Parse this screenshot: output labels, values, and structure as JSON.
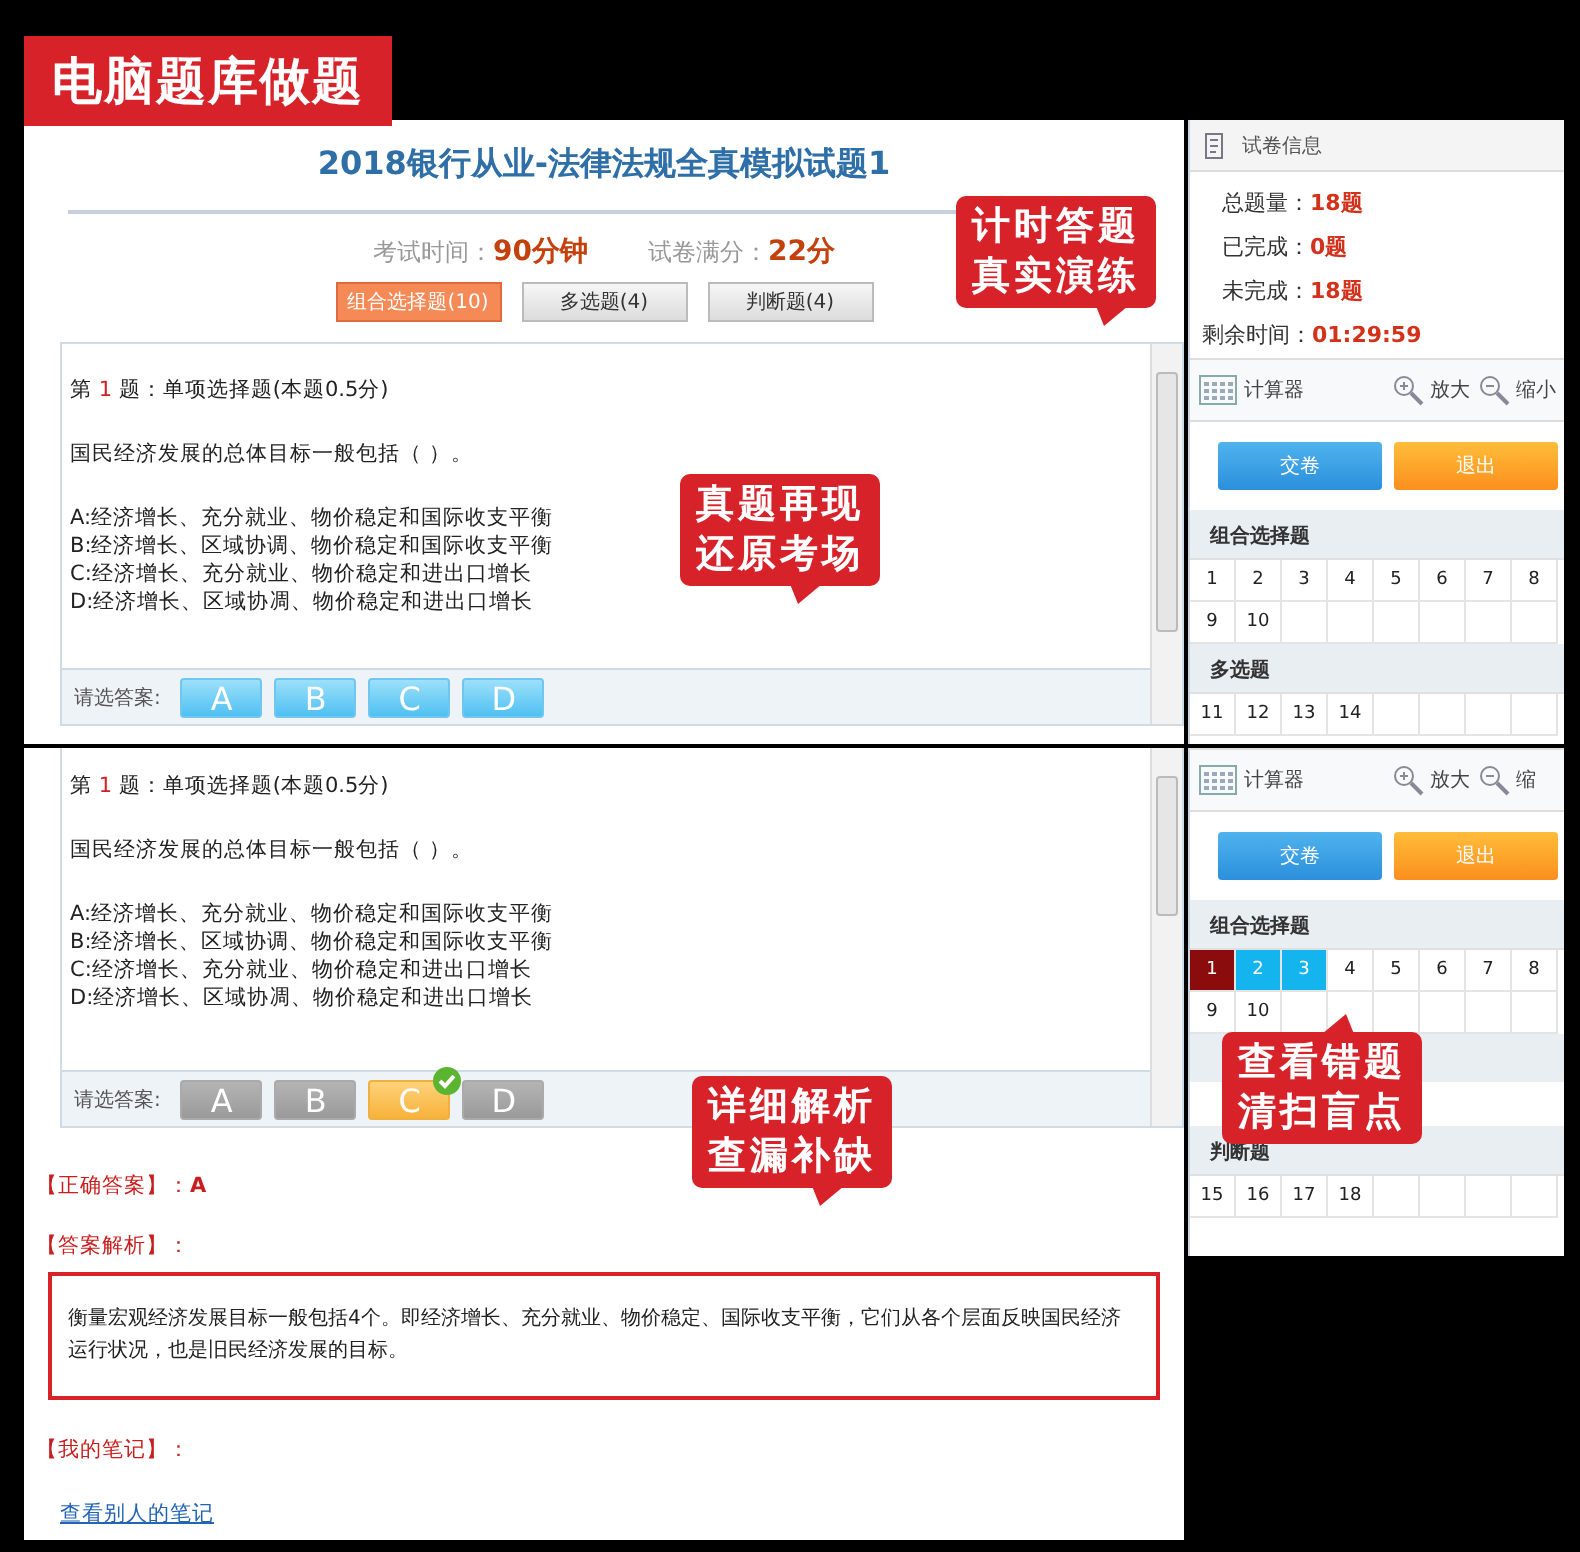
{
  "banner": {
    "title": "电脑题库做题"
  },
  "exam_view": {
    "title": "2018银行从业-法律法规全真模拟试题1",
    "info": [
      {
        "label": "考试时间：",
        "value": "90分钟"
      },
      {
        "label": "试卷满分：",
        "value": "22分"
      }
    ],
    "tabs": [
      {
        "label": "组合选择题(10)",
        "selected": true
      },
      {
        "label": "多选题(4)",
        "selected": false
      },
      {
        "label": "判断题(4)",
        "selected": false
      }
    ],
    "question": {
      "prefix": "第",
      "number": "1",
      "suffix": "题：单项选择题(本题0.5分)",
      "stem": "国民经济发展的总体目标一般包括（ ）。",
      "options": [
        "A:经济增长、充分就业、物价稳定和国际收支平衡",
        "B:经济增长、区域协调、物价稳定和国际收支平衡",
        "C:经济增长、充分就业、物价稳定和进出口增长",
        "D:经济增长、区域协凋、物价稳定和进出口增长"
      ]
    },
    "answer_prompt": "请选答案:",
    "answers_enabled": true,
    "answers": [
      {
        "label": "A",
        "selected": false
      },
      {
        "label": "B",
        "selected": false
      },
      {
        "label": "C",
        "selected": false
      },
      {
        "label": "D",
        "selected": false
      }
    ],
    "callouts": [
      {
        "lines": [
          "计时答题",
          "真实演练"
        ]
      },
      {
        "lines": [
          "真题再现",
          "还原考场"
        ]
      }
    ]
  },
  "exam_sidebar": {
    "header": "试卷信息",
    "stats": [
      {
        "label": "总题量：",
        "value": "18题"
      },
      {
        "label": "已完成：",
        "value": "0题"
      },
      {
        "label": "未完成：",
        "value": "18题"
      },
      {
        "label": "剩余时间：",
        "value": "01:29:59"
      }
    ],
    "tools": [
      {
        "kind": "calculator",
        "label": "计算器"
      },
      {
        "kind": "zoom_in",
        "label": "放大"
      },
      {
        "kind": "zoom_out",
        "label": "缩小"
      }
    ],
    "actions": [
      {
        "kind": "submit",
        "label": "交卷"
      },
      {
        "kind": "exit",
        "label": "退出"
      }
    ],
    "sections": [
      {
        "title": "组合选择题",
        "items": [
          {
            "label": "1"
          },
          {
            "label": "2"
          },
          {
            "label": "3"
          },
          {
            "label": "4"
          },
          {
            "label": "5"
          },
          {
            "label": "6"
          },
          {
            "label": "7"
          },
          {
            "label": "8"
          },
          {
            "label": "9"
          },
          {
            "label": "10"
          }
        ]
      },
      {
        "title": "多选题",
        "items": [
          {
            "label": "11"
          },
          {
            "label": "12"
          },
          {
            "label": "13"
          },
          {
            "label": "14"
          }
        ]
      }
    ]
  },
  "review_view": {
    "question": {
      "prefix": "第",
      "number": "1",
      "suffix": "题：单项选择题(本题0.5分)",
      "stem": "国民经济发展的总体目标一般包括（ ）。",
      "options": [
        "A:经济增长、充分就业、物价稳定和国际收支平衡",
        "B:经济增长、区域协调、物价稳定和国际收支平衡",
        "C:经济增长、充分就业、物价稳定和进出口增长",
        "D:经济增长、区域协凋、物价稳定和进出口增长"
      ]
    },
    "answer_prompt": "请选答案:",
    "answers_enabled": false,
    "answers": [
      {
        "label": "A",
        "selected": false
      },
      {
        "label": "B",
        "selected": false
      },
      {
        "label": "C",
        "selected": true
      },
      {
        "label": "D",
        "selected": false
      }
    ],
    "correct_label": "【正确答案】：",
    "correct_value": "A",
    "analysis_label": "【答案解析】：",
    "analysis": "衡量宏观经济发展目标一般包括4个。即经济增长、充分就业、物价稳定、国际收支平衡，它们从各个层面反映国民经济运行状况，也是旧民经济发展的目标。",
    "notes_label": "【我的笔记】：",
    "notes_link": "查看别人的笔记",
    "callouts": [
      {
        "lines": [
          "详细解析",
          "查漏补缺"
        ]
      }
    ]
  },
  "review_sidebar": {
    "tools": [
      {
        "kind": "calculator",
        "label": "计算器"
      },
      {
        "kind": "zoom_in",
        "label": "放大"
      },
      {
        "kind": "zoom_out",
        "label": "缩"
      }
    ],
    "actions": [
      {
        "kind": "submit",
        "label": "交卷"
      },
      {
        "kind": "exit",
        "label": "退出"
      }
    ],
    "sections": [
      {
        "title": "组合选择题",
        "items": [
          {
            "label": "1",
            "answered": true,
            "wrong": true
          },
          {
            "label": "2",
            "answered": true,
            "wrong": false
          },
          {
            "label": "3",
            "answered": true,
            "wrong": false
          },
          {
            "label": "4",
            "answered": false,
            "wrong": false
          },
          {
            "label": "5",
            "answered": false,
            "wrong": false
          },
          {
            "label": "6",
            "answered": false,
            "wrong": false
          },
          {
            "label": "7",
            "answered": false,
            "wrong": false
          },
          {
            "label": "8",
            "answered": false,
            "wrong": false
          },
          {
            "label": "9",
            "answered": false,
            "wrong": false
          },
          {
            "label": "10",
            "answered": false,
            "wrong": false
          }
        ]
      },
      {
        "title": "判断题",
        "items": [
          {
            "label": "15",
            "answered": false,
            "wrong": false
          },
          {
            "label": "16",
            "answered": false,
            "wrong": false
          },
          {
            "label": "17",
            "answered": false,
            "wrong": false
          },
          {
            "label": "18",
            "answered": false,
            "wrong": false
          }
        ]
      }
    ],
    "callouts": [
      {
        "lines": [
          "查看错题",
          "清扫盲点"
        ]
      }
    ]
  }
}
